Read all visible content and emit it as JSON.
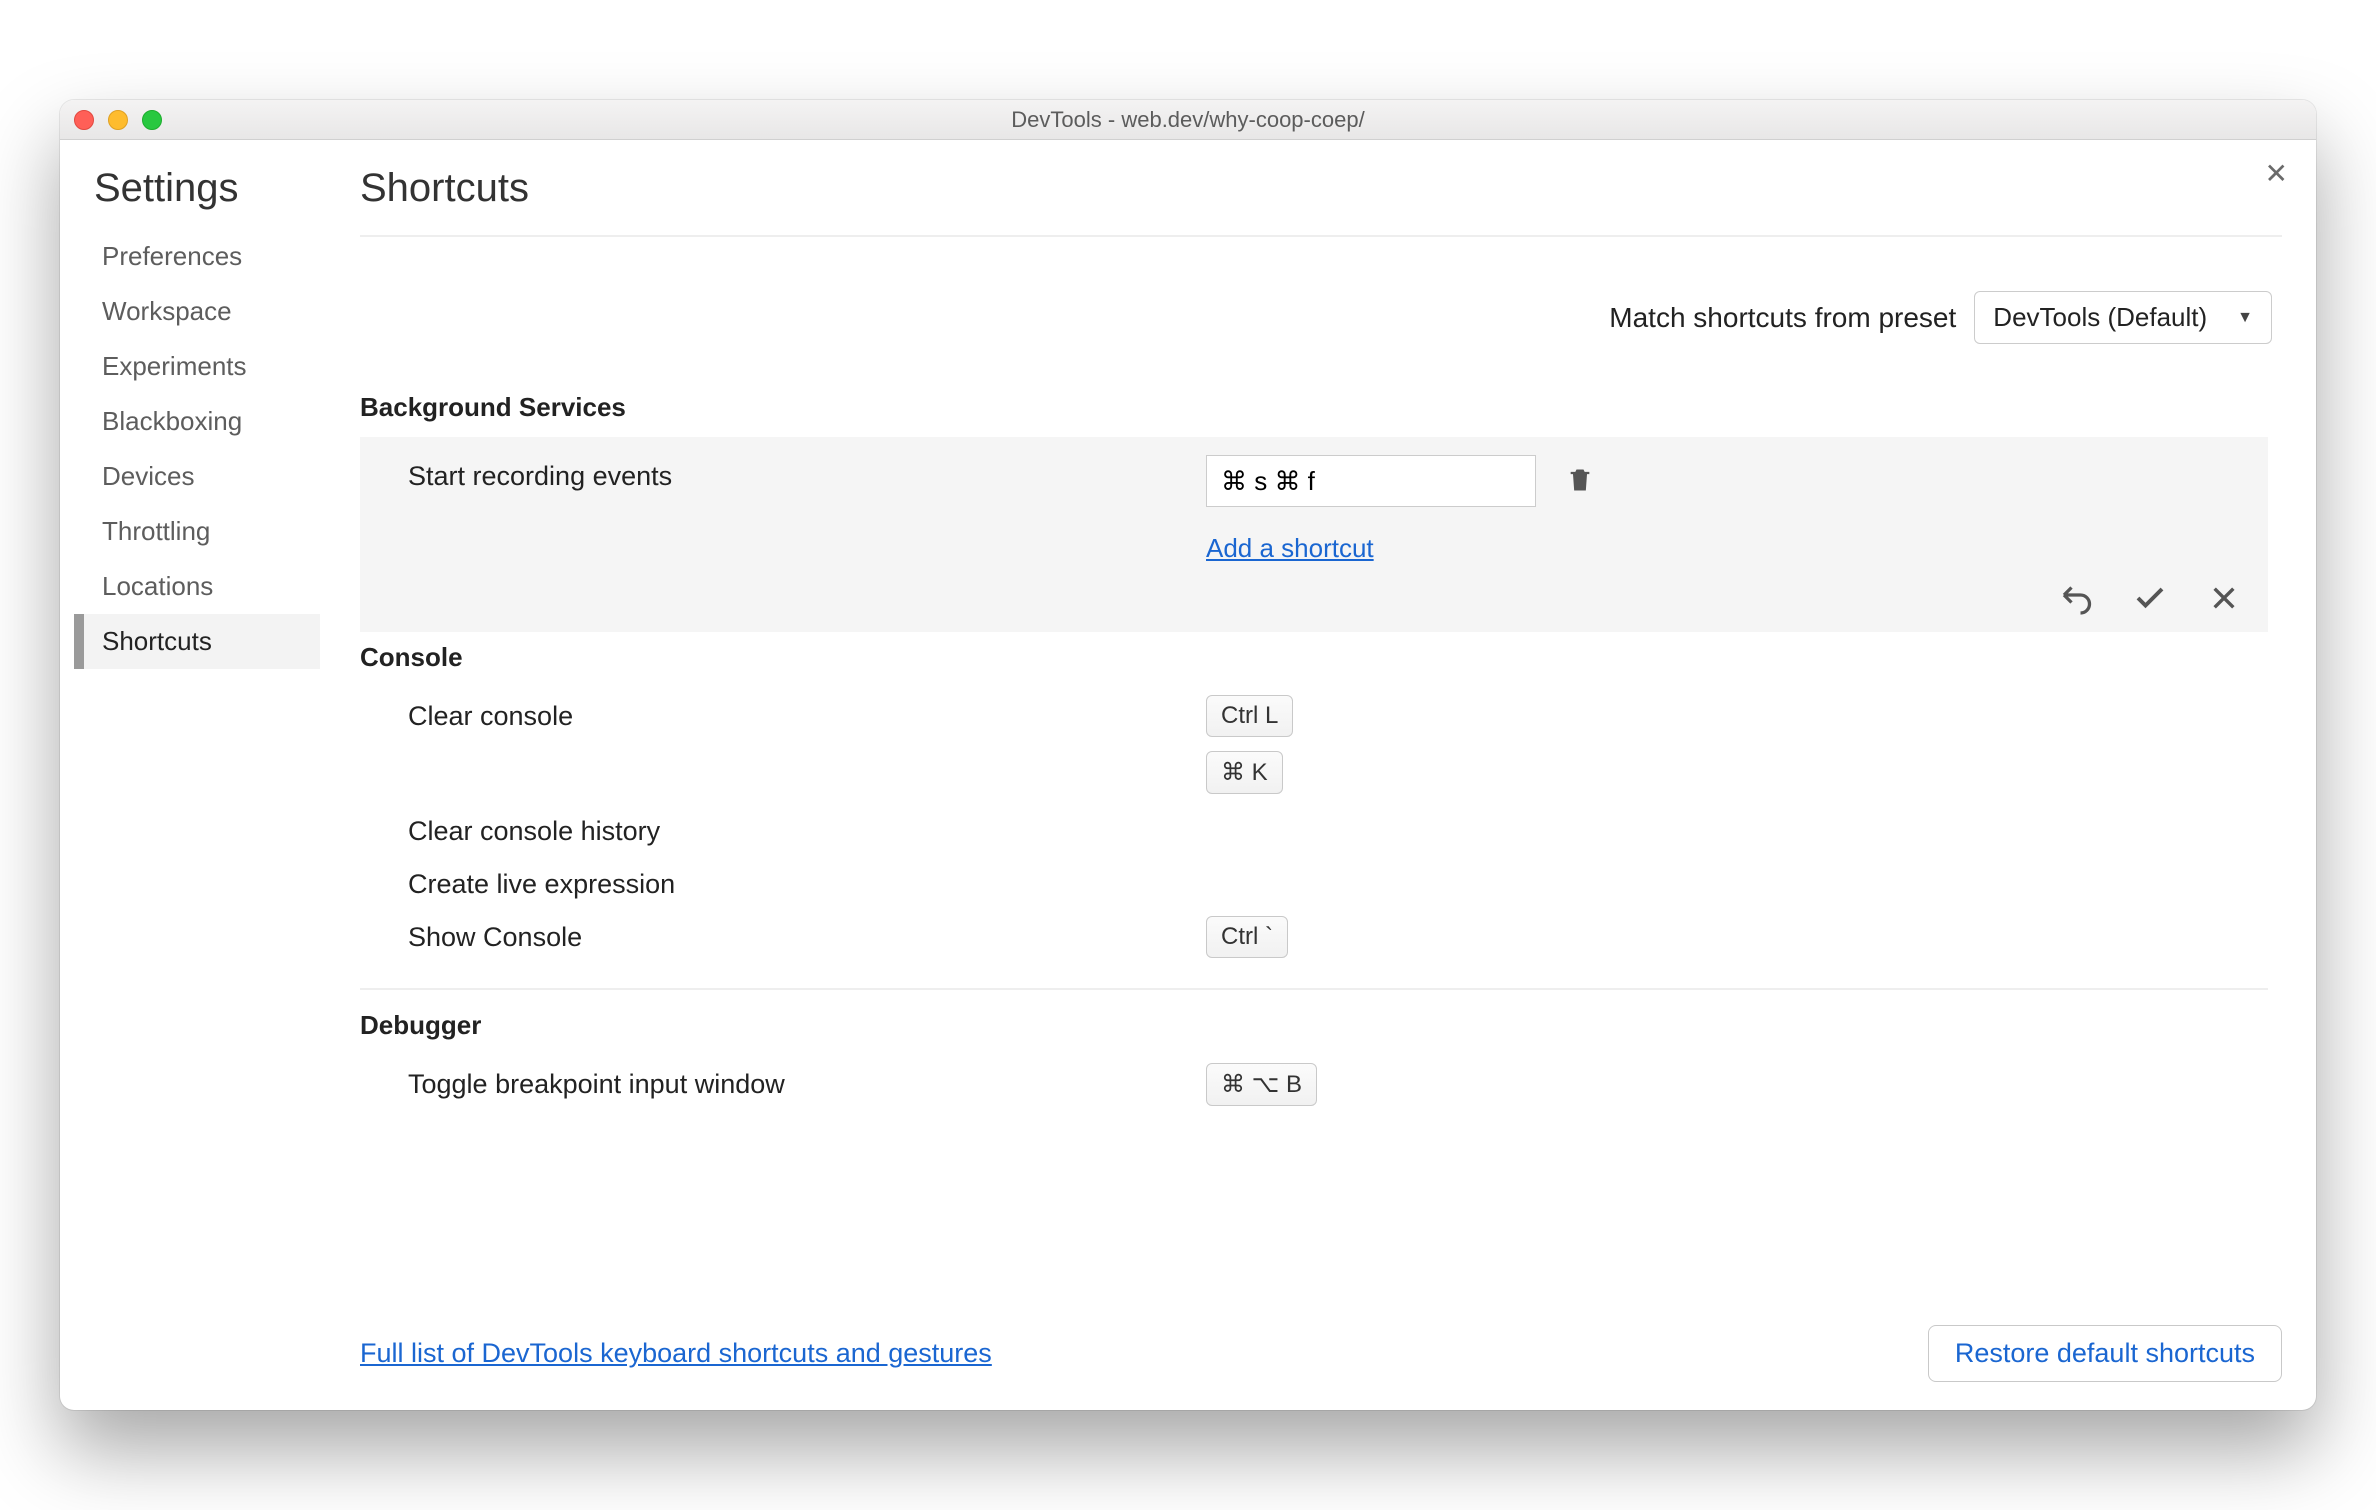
{
  "window": {
    "title": "DevTools - web.dev/why-coop-coep/"
  },
  "sidebar": {
    "heading": "Settings",
    "items": [
      {
        "label": "Preferences"
      },
      {
        "label": "Workspace"
      },
      {
        "label": "Experiments"
      },
      {
        "label": "Blackboxing"
      },
      {
        "label": "Devices"
      },
      {
        "label": "Throttling"
      },
      {
        "label": "Locations"
      },
      {
        "label": "Shortcuts",
        "selected": true
      }
    ]
  },
  "page": {
    "heading": "Shortcuts",
    "preset_label": "Match shortcuts from preset",
    "preset_value": "DevTools (Default)"
  },
  "sections": {
    "bg_services": {
      "title": "Background Services",
      "start_recording": {
        "label": "Start recording events",
        "input_value": "⌘ s ⌘ f",
        "add_link": "Add a shortcut"
      }
    },
    "console": {
      "title": "Console",
      "clear_console": {
        "label": "Clear console",
        "keys": [
          "Ctrl L",
          "⌘ K"
        ]
      },
      "clear_history": {
        "label": "Clear console history"
      },
      "create_live": {
        "label": "Create live expression"
      },
      "show_console": {
        "label": "Show Console",
        "keys": [
          "Ctrl `"
        ]
      }
    },
    "debugger": {
      "title": "Debugger",
      "toggle_bp": {
        "label": "Toggle breakpoint input window",
        "keys": [
          "⌘ ⌥ B"
        ]
      }
    }
  },
  "footer": {
    "link": "Full list of DevTools keyboard shortcuts and gestures",
    "restore": "Restore default shortcuts"
  }
}
